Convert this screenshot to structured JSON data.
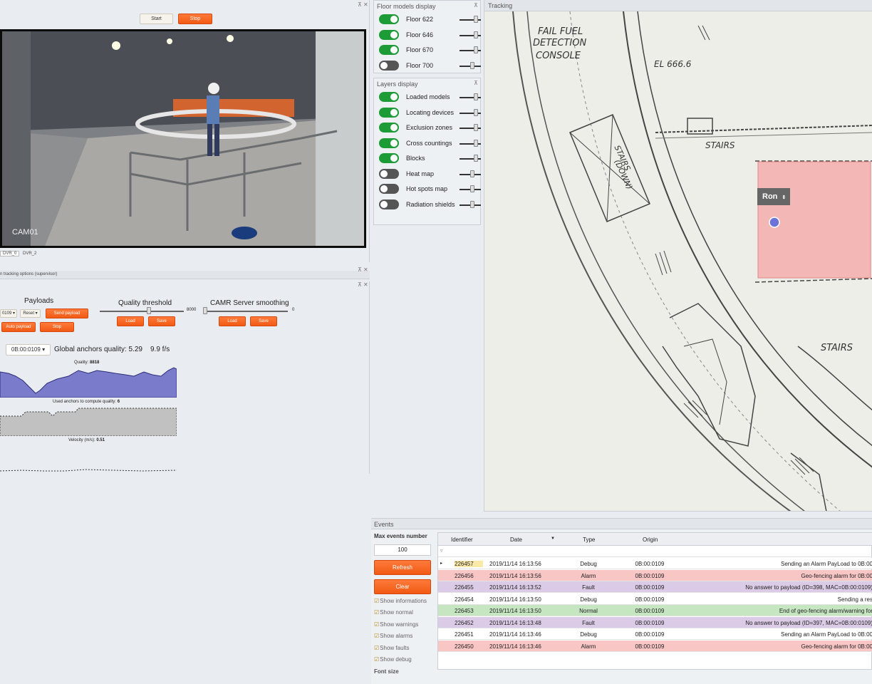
{
  "video": {
    "start_label": "Start",
    "stop_label": "Stop",
    "camera_label": "CAM01",
    "tabs": [
      "DVR_0",
      "DVR_2"
    ]
  },
  "tracking_options": {
    "title": "n tracking options (supervisor)",
    "payloads_title": "Payloads",
    "id_select": "0109",
    "reset_select": "Reset",
    "send_payload": "Send payload",
    "auto_payload": "Auto payload",
    "stop": "Stop",
    "quality_title": "Quality threshold",
    "quality_value": "8000",
    "quality_load": "Load",
    "quality_save": "Save",
    "smoothing_title": "CAMR Server smoothing",
    "smoothing_value": "0",
    "smoothing_load": "Load",
    "smoothing_save": "Save",
    "device_select": "0B:00:0109",
    "global_quality": "Global anchors quality: 5.29",
    "fps": "9.9 f/s",
    "quality_label": "Quality:",
    "quality_num": "8818",
    "anchors_label": "Used anchors to compute quality:",
    "anchors_num": "6",
    "velocity_label": "Velocity (m/s):",
    "velocity_num": "0.51"
  },
  "floors": {
    "title": "Floor models display",
    "items": [
      {
        "label": "Floor 622",
        "on": true
      },
      {
        "label": "Floor 646",
        "on": true
      },
      {
        "label": "Floor 670",
        "on": true
      },
      {
        "label": "Floor 700",
        "on": false
      }
    ]
  },
  "layers": {
    "title": "Layers display",
    "items": [
      {
        "label": "Loaded models",
        "on": true
      },
      {
        "label": "Locating devices",
        "on": true
      },
      {
        "label": "Exclusion zones",
        "on": true
      },
      {
        "label": "Cross countings",
        "on": true
      },
      {
        "label": "Blocks",
        "on": true
      },
      {
        "label": "Heat map",
        "on": false
      },
      {
        "label": "Hot spots map",
        "on": false
      },
      {
        "label": "Radiation shields",
        "on": false
      }
    ]
  },
  "tracking": {
    "title": "Tracking",
    "person_label": "Ron",
    "map_text": [
      "FAIL FUEL",
      "DETECTION",
      "CONSOLE",
      "EL 666.6",
      "STAIRS",
      "STAIRS",
      "(DOWN)",
      "STAIRS"
    ]
  },
  "events": {
    "title": "Events",
    "max_label": "Max events number",
    "max_value": "100",
    "refresh": "Refresh",
    "clear": "Clear",
    "checkboxes": [
      "Show informations",
      "Show normal",
      "Show warnings",
      "Show alarms",
      "Show faults",
      "Show debug"
    ],
    "font_size_label": "Font size",
    "columns": [
      "Identifier",
      "Date",
      "Type",
      "Origin"
    ],
    "rows": [
      {
        "id": "226457",
        "date": "2019/11/14 16:13:56",
        "type": "Debug",
        "origin": "0B:00:0109",
        "msg": "Sending an Alarm PayLoad to 0B:00",
        "color": "#ffffff"
      },
      {
        "id": "226456",
        "date": "2019/11/14 16:13:56",
        "type": "Alarm",
        "origin": "0B:00:0109",
        "msg": "Geo-fencing alarm for 0B:00",
        "color": "#f9c6c6"
      },
      {
        "id": "226455",
        "date": "2019/11/14 16:13:52",
        "type": "Fault",
        "origin": "0B:00:0109",
        "msg": "No answer to payload (ID=398, MAC=0B:00:0109)",
        "color": "#dccbe6"
      },
      {
        "id": "226454",
        "date": "2019/11/14 16:13:50",
        "type": "Debug",
        "origin": "0B:00:0109",
        "msg": "Sending a res",
        "color": "#ffffff"
      },
      {
        "id": "226453",
        "date": "2019/11/14 16:13:50",
        "type": "Normal",
        "origin": "0B:00:0109",
        "msg": "End of geo-fencing alarm/warning for",
        "color": "#c6e6c2"
      },
      {
        "id": "226452",
        "date": "2019/11/14 16:13:48",
        "type": "Fault",
        "origin": "0B:00:0109",
        "msg": "No answer to payload (ID=397, MAC=0B:00:0109)",
        "color": "#dccbe6"
      },
      {
        "id": "226451",
        "date": "2019/11/14 16:13:46",
        "type": "Debug",
        "origin": "0B:00:0109",
        "msg": "Sending an Alarm PayLoad to 0B:00",
        "color": "#ffffff"
      },
      {
        "id": "226450",
        "date": "2019/11/14 16:13:46",
        "type": "Alarm",
        "origin": "0B:00:0109",
        "msg": "Geo-fencing alarm for 0B:00",
        "color": "#f9c6c6"
      }
    ]
  }
}
